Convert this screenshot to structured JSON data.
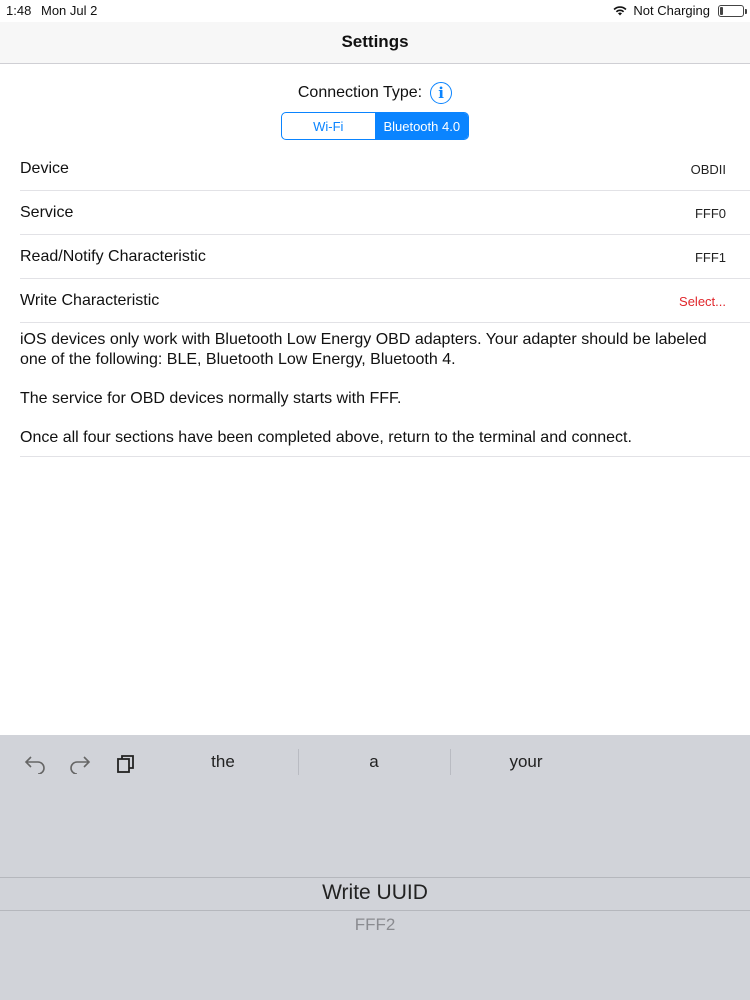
{
  "status_bar": {
    "time": "1:48",
    "date": "Mon Jul 2",
    "charging": "Not Charging",
    "wifi_icon": "wifi-icon",
    "battery_icon": "battery-icon"
  },
  "nav": {
    "title": "Settings"
  },
  "connection": {
    "label": "Connection Type:",
    "info_icon": "i",
    "segments": [
      "Wi-Fi",
      "Bluetooth 4.0"
    ],
    "selected": "Bluetooth 4.0",
    "accent": "#0a84ff"
  },
  "rows": [
    {
      "label": "Device",
      "value": "OBDII"
    },
    {
      "label": "Service",
      "value": "FFF0"
    },
    {
      "label": "Read/Notify Characteristic",
      "value": "FFF1"
    },
    {
      "label": "Write Characteristic",
      "value": "Select...",
      "value_color": "#e0262b"
    }
  ],
  "notes": [
    "iOS devices only work with Bluetooth Low Energy OBD adapters.  Your adapter should be labeled one of the following: BLE, Bluetooth Low Energy, Bluetooth 4.",
    "The service for OBD devices normally starts with FFF.",
    "Once all four sections have been completed above, return to the terminal and connect."
  ],
  "keyboard": {
    "tools": [
      "undo-icon",
      "redo-icon",
      "paste-icon"
    ],
    "suggestions": [
      "the",
      "a",
      "your"
    ],
    "picker_selected": "Write UUID",
    "picker_next": "FFF2"
  }
}
